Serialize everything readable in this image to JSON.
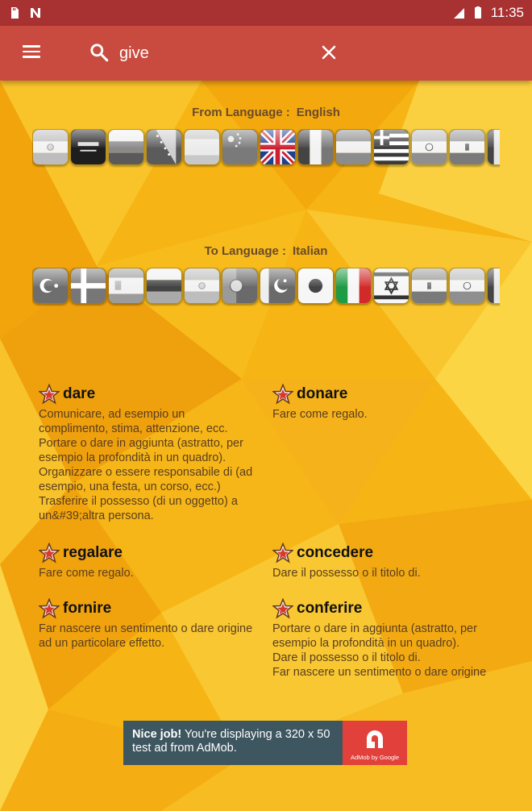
{
  "status_bar": {
    "time": "11:35",
    "network": "LTE"
  },
  "toolbar": {
    "search_value": "give",
    "search_placeholder": ""
  },
  "from_language": {
    "label": "From Language :",
    "value": "English"
  },
  "to_language": {
    "label": "To Language :",
    "value": "Italian"
  },
  "from_flags": [
    "argentina",
    "saudi-arabia",
    "bulgaria",
    "bosnia",
    "spain-bw",
    "china",
    "united-kingdom",
    "france",
    "austria",
    "greece",
    "india",
    "iran",
    "partial"
  ],
  "to_flags": [
    "turkey",
    "denmark",
    "spain",
    "germany",
    "argentina",
    "portugal",
    "pakistan",
    "japan",
    "italy",
    "israel",
    "iran",
    "india",
    "partial"
  ],
  "results": [
    {
      "word": "dare",
      "definition": "Comunicare, ad esempio un\ncomplimento, stima, attenzione, ecc.\nPortare o dare in aggiunta (astratto, per\nesempio la profondità in un quadro).\nOrganizzare o essere responsabile di (ad\nesempio, una festa, un corso, ecc.)\nTrasferire il possesso (di un oggetto) a\nun&#39;altra persona."
    },
    {
      "word": "donare",
      "definition": "Fare come regalo."
    },
    {
      "word": "regalare",
      "definition": "Fare come regalo."
    },
    {
      "word": "concedere",
      "definition": "Dare il possesso o il titolo di."
    },
    {
      "word": "fornire",
      "definition": "Far nascere un sentimento o dare origine\nad un particolare effetto."
    },
    {
      "word": "conferire",
      "definition": "Portare o dare in aggiunta (astratto, per\nesempio la profondità in un quadro).\nDare il possesso o il titolo di.\nFar nascere un sentimento o dare origine"
    }
  ],
  "ad": {
    "headline": "Nice job!",
    "text": " You're displaying a 320 x 50 test ad from AdMob.",
    "brand": "AdMob by Google"
  }
}
